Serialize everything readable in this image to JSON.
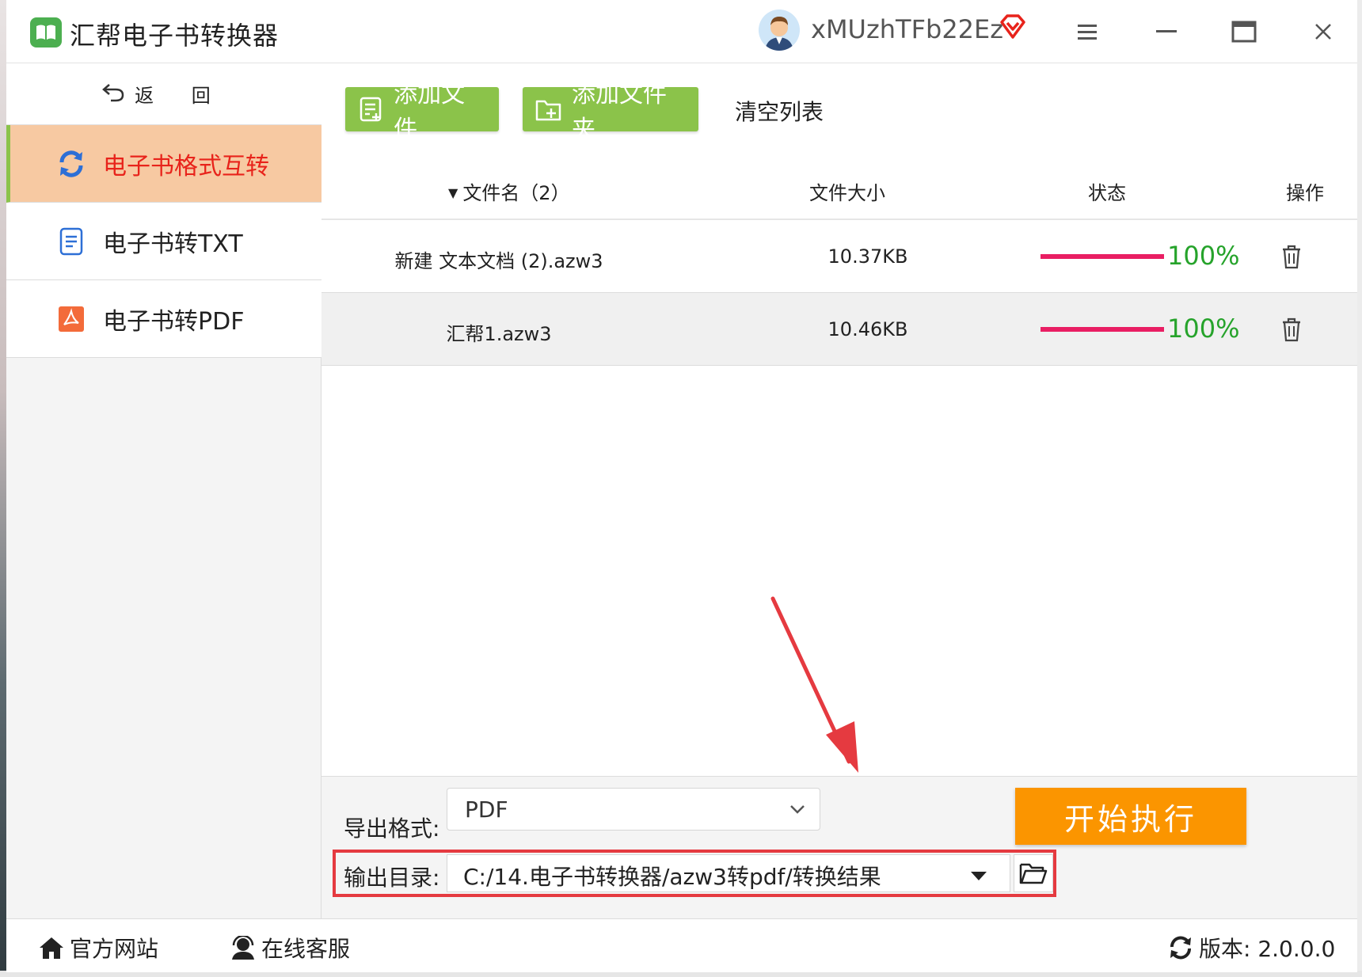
{
  "app": {
    "title": "汇帮电子书转换器",
    "username": "xMUzhTFb22Ez"
  },
  "sidebar": {
    "back_label": "返 回",
    "back_arrow": "⟲",
    "items": [
      {
        "label": "电子书格式互转",
        "icon": "refresh-icon",
        "active": true
      },
      {
        "label": "电子书转TXT",
        "icon": "document-icon",
        "active": false
      },
      {
        "label": "电子书转PDF",
        "icon": "pdf-icon",
        "active": false
      }
    ]
  },
  "toolbar": {
    "add_file": "添加文件",
    "add_folder": "添加文件夹",
    "clear_list": "清空列表"
  },
  "table": {
    "headers": {
      "name": "文件名（2）",
      "size": "文件大小",
      "status": "状态",
      "action": "操作"
    },
    "rows": [
      {
        "name": "新建 文本文档 (2).azw3",
        "size": "10.37KB",
        "progress": 100,
        "progress_text": "100%"
      },
      {
        "name": "汇帮1.azw3",
        "size": "10.46KB",
        "progress": 100,
        "progress_text": "100%"
      }
    ]
  },
  "config": {
    "format_label": "导出格式:",
    "format_value": "PDF",
    "output_label": "输出目录:",
    "output_value": "C:/14.电子书转换器/azw3转pdf/转换结果",
    "start_label": "开始执行"
  },
  "footer": {
    "site": "官方网站",
    "support": "在线客服",
    "version": "版本:  2.0.0.0"
  },
  "colors": {
    "accent_green": "#8bc34a",
    "active_bg": "#f7c9a2",
    "active_text": "#e8231b",
    "progress": "#e91e63",
    "progress_text": "#26a32b",
    "start_button": "#fb9500",
    "annotation_red": "#e53a40"
  }
}
